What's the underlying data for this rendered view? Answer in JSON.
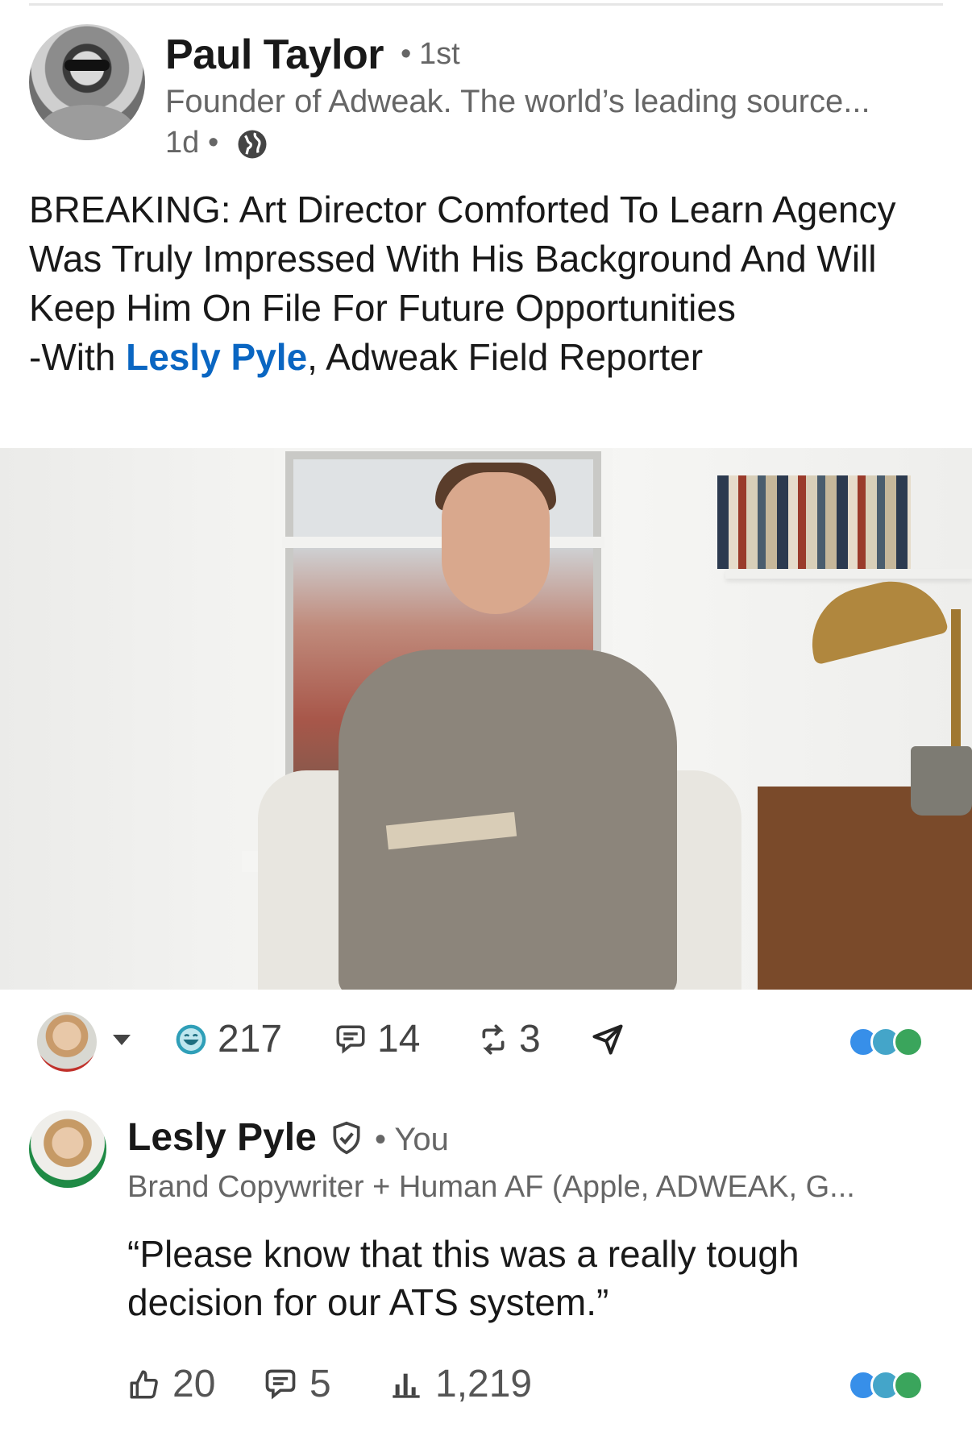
{
  "author": {
    "name": "Paul Taylor",
    "degree": "1st",
    "headline": "Founder of Adweak. The world’s leading source...",
    "time": "1d",
    "separator": "•",
    "visibility_icon": "globe-icon"
  },
  "post": {
    "text_before": "BREAKING: Art Director Comforted To Learn Agency Was Truly Impressed With His Background And Will Keep Him On File For Future Opportunities",
    "with_prefix": "-With ",
    "mention": "Lesly Pyle",
    "text_after": ", Adweak Field Reporter"
  },
  "social_bar": {
    "reactions_count": "217",
    "comments_count": "14",
    "reposts_count": "3",
    "reaction_icons": [
      "like-icon",
      "funny-icon",
      "support-icon"
    ]
  },
  "comment": {
    "name": "Lesly Pyle",
    "you_label": "• You",
    "headline": "Brand Copywriter + Human AF (Apple, ADWEAK, G...",
    "text": "“Please know that this was a really tough decision for our ATS system.”",
    "likes_count": "20",
    "replies_count": "5",
    "impressions_count": "1,219"
  },
  "colors": {
    "link": "#0a66c2",
    "secondary_text": "#666666",
    "like": "#378fe9",
    "funny": "#44a5c9",
    "support": "#3aa55c"
  }
}
